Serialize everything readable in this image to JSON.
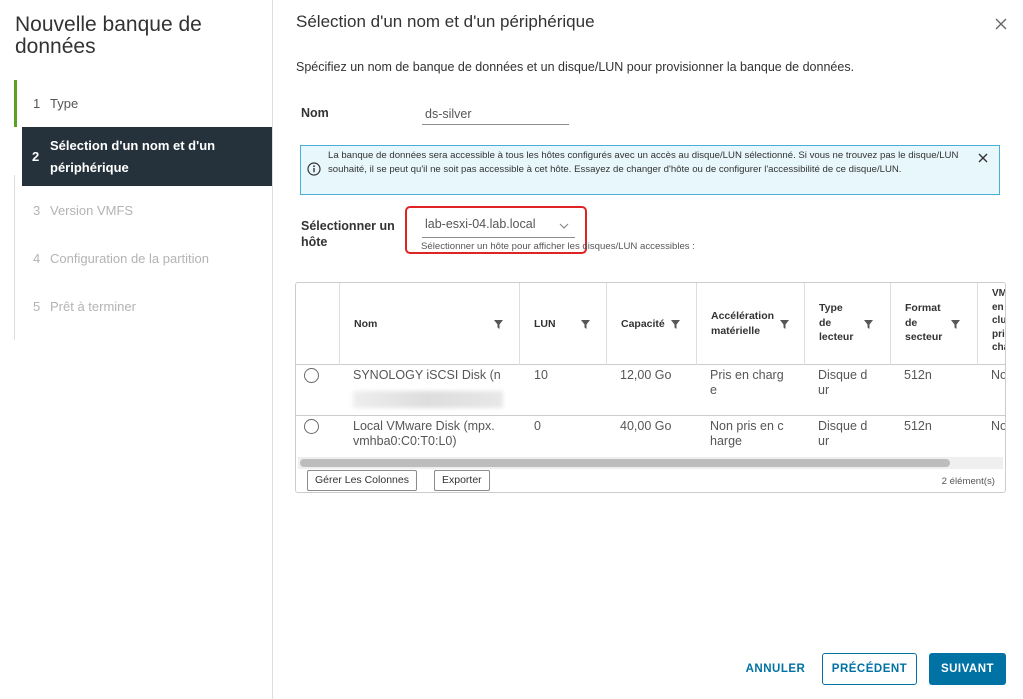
{
  "sidebar": {
    "title": "Nouvelle banque de données",
    "steps": [
      {
        "num": "1",
        "label": "Type",
        "state": "done"
      },
      {
        "num": "2",
        "label": "Sélection d'un nom et d'un périphérique",
        "state": "active"
      },
      {
        "num": "3",
        "label": "Version VMFS",
        "state": "disabled"
      },
      {
        "num": "4",
        "label": "Configuration de la partition",
        "state": "disabled"
      },
      {
        "num": "5",
        "label": "Prêt à terminer",
        "state": "disabled"
      }
    ]
  },
  "main": {
    "title": "Sélection d'un nom et d'un périphérique",
    "intro": "Spécifiez un nom de banque de données et un disque/LUN pour provisionner la banque de données.",
    "name_label": "Nom",
    "name_value": "ds-silver",
    "info_text": "La banque de données sera accessible à tous les hôtes configurés avec un accès au disque/LUN sélectionné. Si vous ne trouvez pas le disque/LUN souhaité, il se peut qu'il ne soit pas accessible à cet hôte. Essayez de changer d'hôte ou de configurer l'accessibilité de ce disque/LUN.",
    "host_label": "Sélectionner un hôte",
    "host_value": "lab-esxi-04.lab.local",
    "host_hint": "Sélectionner un hôte pour afficher les disques/LUN accessibles :"
  },
  "grid": {
    "columns": [
      "Nom",
      "LUN",
      "Capacité",
      "Accélération matérielle",
      "Type de lecteur",
      "Format de secteur",
      "VMFS en cluster pris en charge"
    ],
    "column_fragments": [
      "VM",
      "en",
      "clu",
      "pri",
      "cha"
    ],
    "rows": [
      {
        "name": "SYNOLOGY iSCSI Disk (n",
        "lun": "10",
        "capacity": "12,00 Go",
        "accel": "Pris en charg e",
        "type": "Disque d ur",
        "format": "512n",
        "cluster": "No"
      },
      {
        "name": "Local VMware Disk (mpx. vmhba0:C0:T0:L0)",
        "lun": "0",
        "capacity": "40,00 Go",
        "accel": "Non pris en c harge",
        "type": "Disque d ur",
        "format": "512n",
        "cluster": "No"
      }
    ],
    "manage_columns": "Gérer Les Colonnes",
    "export": "Exporter",
    "count": "2 élément(s)"
  },
  "buttons": {
    "cancel": "ANNULER",
    "previous": "PRÉCÉDENT",
    "next": "SUIVANT"
  },
  "colors": {
    "accent": "#0072a3",
    "active_step_bg": "#26323b",
    "done_step": "#5aa220",
    "info_bg": "#e8f7fb",
    "info_border": "#49afd9",
    "highlight": "#e02323"
  }
}
